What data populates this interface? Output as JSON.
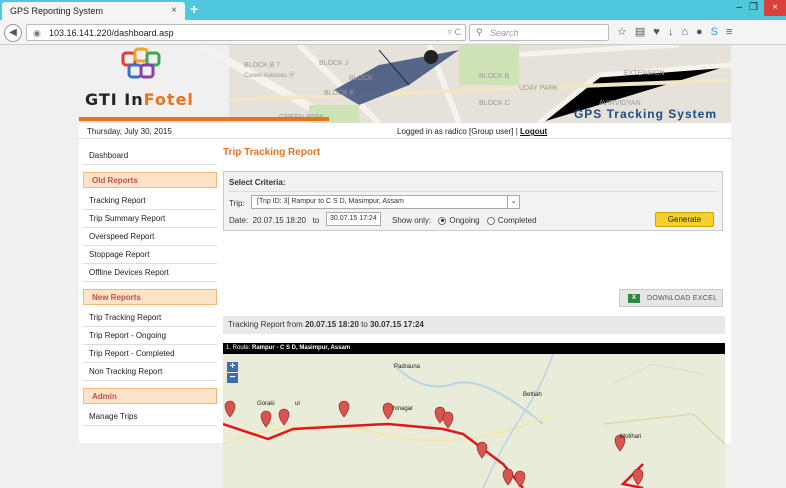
{
  "browser": {
    "tab_title": "GPS Reporting System",
    "tab_close": "×",
    "new_tab": "+",
    "url": "103.16.141.220/dashboard.asp",
    "search_placeholder": "Search",
    "window_min": "–",
    "window_max": "❐",
    "window_close": "×"
  },
  "header": {
    "logo_main": "GTI In",
    "logo_accent": "Fotel",
    "system_title": "GPS Tracking System"
  },
  "infobar": {
    "date": "Thursday, July 30, 2015",
    "login_text": "Logged in as radico  [Group user]  | ",
    "logout": "Logout"
  },
  "sidebar": {
    "dashboard": "Dashboard",
    "old_reports_head": "Old Reports",
    "old_reports": [
      "Tracking Report",
      "Trip Summary Report",
      "Overspeed Report",
      "Stoppage Report",
      "Offline Devices Report"
    ],
    "new_reports_head": "New Reports",
    "new_reports": [
      "Trip Tracking Report",
      "Trip Report - Ongoing",
      "Trip Report - Completed",
      "Non Tracking Report"
    ],
    "admin_head": "Admin",
    "admin_items": [
      "Manage Trips"
    ]
  },
  "main": {
    "title": "Trip Tracking Report",
    "criteria_label": "Select Criteria:",
    "trip_label": "Trip:",
    "trip_value": "[Trip ID: 3] Rampur to C S D, Masimpur, Assam",
    "date_label": "Date:",
    "from_date": "20.07.15 18:20",
    "to_label": "to",
    "to_date": "30.07.15 17:24",
    "show_only_label": "Show only:",
    "ongoing_label": "Ongoing",
    "completed_label": "Completed",
    "ongoing_selected": true,
    "generate_label": "Generate",
    "download_label": "DOWNLOAD EXCEL",
    "download_icon": "excel-icon",
    "range_prefix": "Tracking Report from ",
    "range_from": "20.07.15 18:20",
    "range_to_word": " to ",
    "range_to": "30.07.15 17:24",
    "route_prefix": "1. Route: ",
    "route_name": "Rampur - C S D, Masimpur, Assam"
  },
  "map": {
    "zoom_in": "+",
    "zoom_out": "−",
    "labels": [
      "Padrauna",
      "Bettiah",
      "Goraki",
      "ur",
      "hinagar",
      "Motihari"
    ]
  }
}
